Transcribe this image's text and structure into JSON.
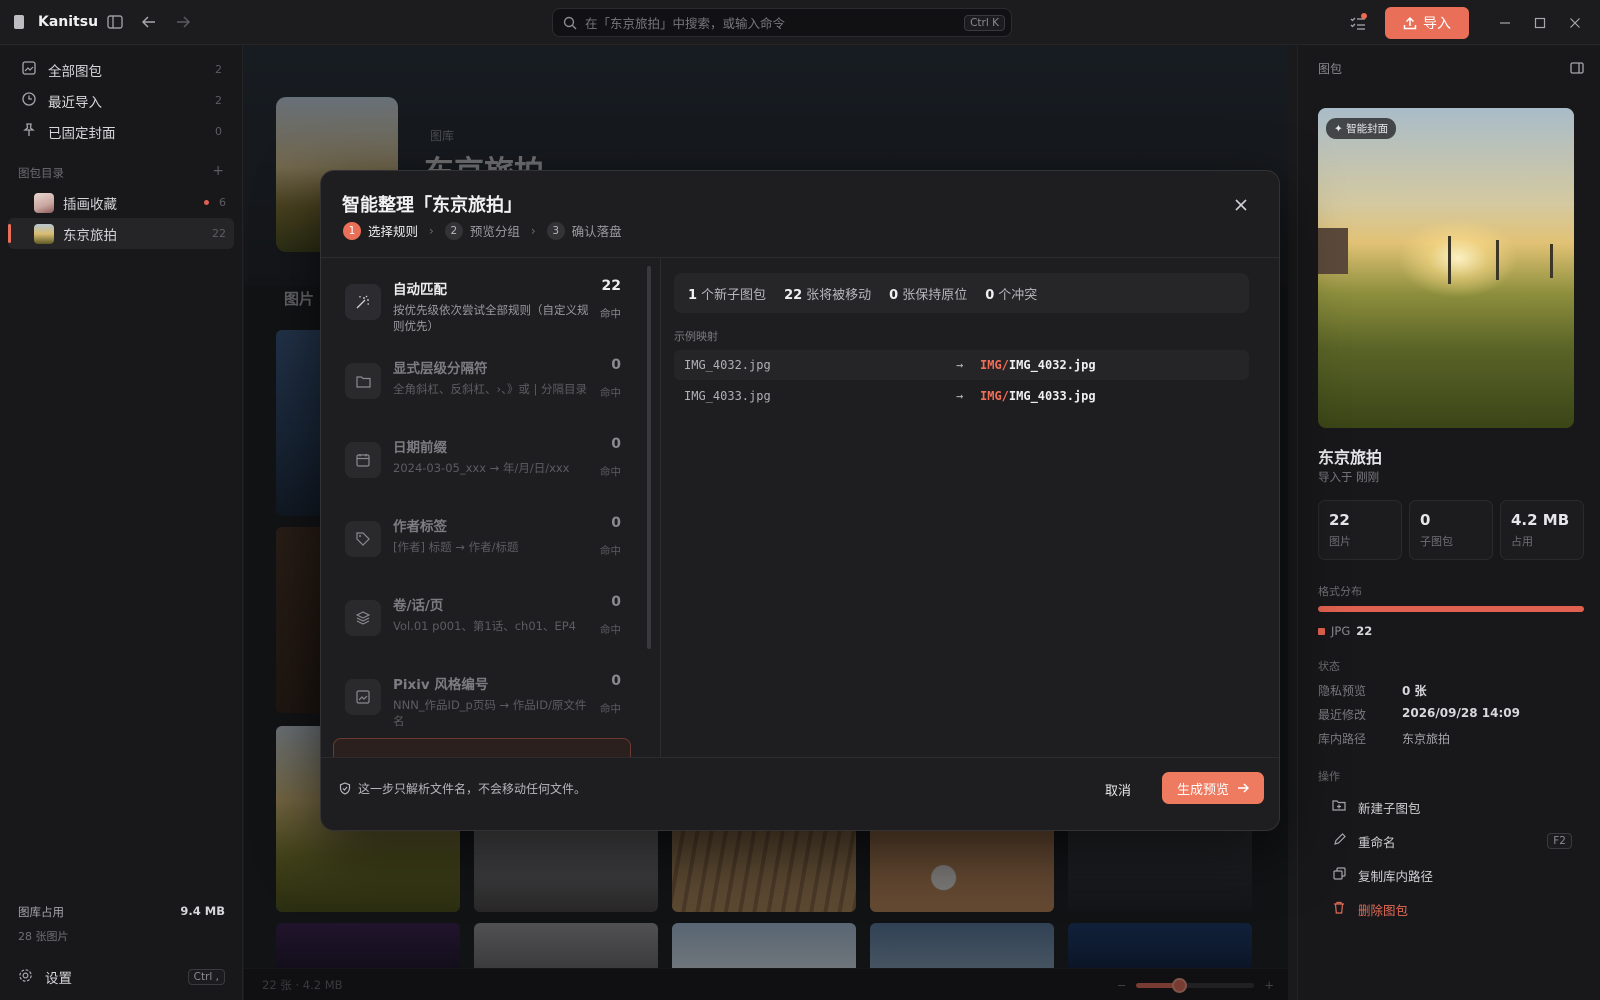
{
  "app": {
    "name": "Kanitsu",
    "search_placeholder": "在「东京旅拍」中搜索，或输入命令",
    "search_shortcut": "Ctrl K",
    "import_label": "导入"
  },
  "sidebar": {
    "nav": [
      {
        "label": "全部图包",
        "count": "2",
        "icon": "gallery-icon"
      },
      {
        "label": "最近导入",
        "count": "2",
        "icon": "clock-icon"
      },
      {
        "label": "已固定封面",
        "count": "0",
        "icon": "pin-icon"
      }
    ],
    "section_title": "图包目录",
    "libraries": [
      {
        "label": "插画收藏",
        "count": "6",
        "has_dot": true
      },
      {
        "label": "东京旅拍",
        "count": "22",
        "active": true
      }
    ],
    "usage_label": "图库占用",
    "usage_value": "9.4 MB",
    "usage_count": "28 张图片",
    "settings_label": "设置",
    "settings_shortcut": "Ctrl ,"
  },
  "main": {
    "hero_sub": "图库",
    "hero_title": "东京旅拍",
    "grid_label": "图片",
    "status": "22 张 · 4.2 MB",
    "zoom_level": 0.36
  },
  "right_panel": {
    "header": "图包",
    "cover_badge": "✦ 智能封面",
    "title": "东京旅拍",
    "subtitle": "导入于 刚刚",
    "stats": [
      {
        "value": "22",
        "label": "图片"
      },
      {
        "value": "0",
        "label": "子图包"
      },
      {
        "value": "4.2 MB",
        "label": "占用"
      }
    ],
    "format_title": "格式分布",
    "format_name": "JPG",
    "format_count": "22",
    "status_title": "状态",
    "props": [
      {
        "k": "隐私预览",
        "v": "0 张"
      },
      {
        "k": "最近修改",
        "v": "2026/09/28 14:09"
      },
      {
        "k": "库内路径",
        "v": "东京旅拍"
      }
    ],
    "actions_title": "操作",
    "actions": [
      {
        "label": "新建子图包",
        "icon": "folder-plus-icon"
      },
      {
        "label": "重命名",
        "icon": "pencil-icon",
        "shortcut": "F2"
      },
      {
        "label": "复制库内路径",
        "icon": "copy-icon"
      },
      {
        "label": "删除图包",
        "icon": "trash-icon",
        "danger": true
      }
    ]
  },
  "modal": {
    "title": "智能整理「东京旅拍」",
    "steps": [
      {
        "n": "1",
        "label": "选择规则",
        "active": true
      },
      {
        "n": "2",
        "label": "预览分组"
      },
      {
        "n": "3",
        "label": "确认落盘"
      }
    ],
    "rules": [
      {
        "title": "自动匹配",
        "desc": "按优先级依次尝试全部规则（自定义规则优先）",
        "count": "22",
        "hit": "命中",
        "icon": "magic-wand-icon",
        "active": true
      },
      {
        "title": "显式层级分隔符",
        "desc": "全角斜杠、反斜杠、›、》或 | 分隔目录",
        "count": "0",
        "hit": "命中",
        "icon": "folder-icon"
      },
      {
        "title": "日期前缀",
        "desc": "2024-03-05_xxx → 年/月/日/xxx",
        "count": "0",
        "hit": "命中",
        "icon": "calendar-icon"
      },
      {
        "title": "作者标签",
        "desc": "[作者] 标题 → 作者/标题",
        "count": "0",
        "hit": "命中",
        "icon": "tag-icon"
      },
      {
        "title": "卷/话/页",
        "desc": "Vol.01 p001、第1话、ch01、EP4",
        "count": "0",
        "hit": "命中",
        "icon": "layers-icon"
      },
      {
        "title": "Pixiv 风格编号",
        "desc": "NNN_作品ID_p页码 → 作品ID/原文件名",
        "count": "0",
        "hit": "命中",
        "icon": "image-icon"
      }
    ],
    "summary": [
      {
        "num": "1",
        "text": "个新子图包"
      },
      {
        "num": "22",
        "text": "张将被移动"
      },
      {
        "num": "0",
        "text": "张保持原位"
      },
      {
        "num": "0",
        "text": "个冲突"
      }
    ],
    "mapping_label": "示例映射",
    "mappings": [
      {
        "src": "IMG_4032.jpg",
        "prefix": "IMG/",
        "dst": "IMG_4032.jpg"
      },
      {
        "src": "IMG_4033.jpg",
        "prefix": "IMG/",
        "dst": "IMG_4033.jpg"
      }
    ],
    "footer_note": "这一步只解析文件名，不会移动任何文件。",
    "cancel_label": "取消",
    "primary_label": "生成预览"
  }
}
